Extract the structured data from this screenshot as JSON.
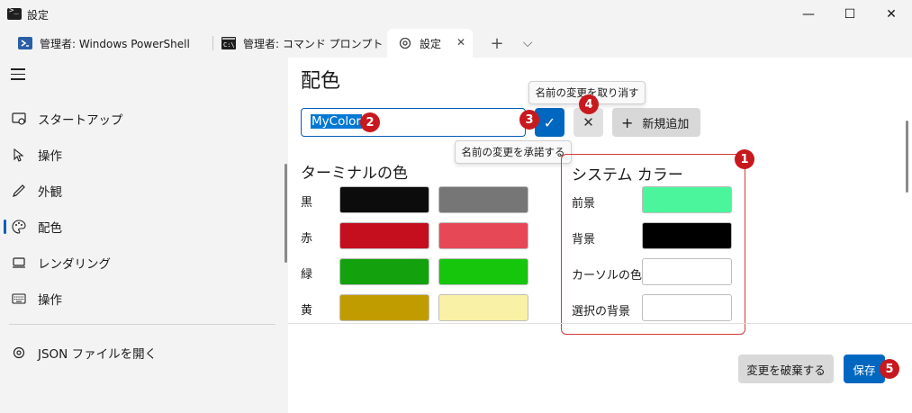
{
  "window": {
    "title": "設定"
  },
  "window_controls": {
    "minimize": "—",
    "maximize": "☐",
    "close": "✕"
  },
  "tabs": [
    {
      "label": "管理者: Windows PowerShell",
      "icon": "powershell-icon"
    },
    {
      "label": "管理者: コマンド プロンプト",
      "icon": "cmd-icon"
    },
    {
      "label": "設定",
      "icon": "gear-icon"
    }
  ],
  "tab_actions": {
    "new": "+",
    "dropdown": "⌵",
    "close": "✕"
  },
  "sidebar": {
    "items": [
      {
        "label": "スタートアップ",
        "icon": "startup-icon"
      },
      {
        "label": "操作",
        "icon": "interaction-icon"
      },
      {
        "label": "外観",
        "icon": "appearance-icon"
      },
      {
        "label": "配色",
        "icon": "palette-icon"
      },
      {
        "label": "レンダリング",
        "icon": "rendering-icon"
      },
      {
        "label": "操作",
        "icon": "keyboard-icon"
      }
    ],
    "json_label": "JSON ファイルを開く"
  },
  "main": {
    "heading": "配色",
    "scheme_name": "MyColor",
    "accept_icon": "✓",
    "cancel_icon": "✕",
    "new_button": {
      "plus": "+",
      "label": "新規追加"
    },
    "tooltip_cancel": "名前の変更を取り消す",
    "tooltip_accept": "名前の変更を承諾する",
    "terminal_colors": {
      "title": "ターミナルの色",
      "rows": [
        {
          "label": "黒",
          "normal": "#0c0c0c",
          "bright": "#767676"
        },
        {
          "label": "赤",
          "normal": "#c50f1f",
          "bright": "#e74856"
        },
        {
          "label": "緑",
          "normal": "#13a10e",
          "bright": "#16c60c"
        },
        {
          "label": "黄",
          "normal": "#c19c00",
          "bright": "#f9f1a5"
        }
      ]
    },
    "system_colors": {
      "title": "システム カラー",
      "rows": [
        {
          "label": "前景",
          "color": "#4bf59c"
        },
        {
          "label": "背景",
          "color": "#000000"
        },
        {
          "label": "カーソルの色",
          "color": "#ffffff"
        },
        {
          "label": "選択の背景",
          "color": "#ffffff"
        }
      ]
    },
    "discard_label": "変更を破棄する",
    "save_label": "保存"
  },
  "badges": [
    "1",
    "2",
    "3",
    "4",
    "5"
  ],
  "colors": {
    "accent": "#0067c0",
    "annotation": "#c8191e"
  }
}
